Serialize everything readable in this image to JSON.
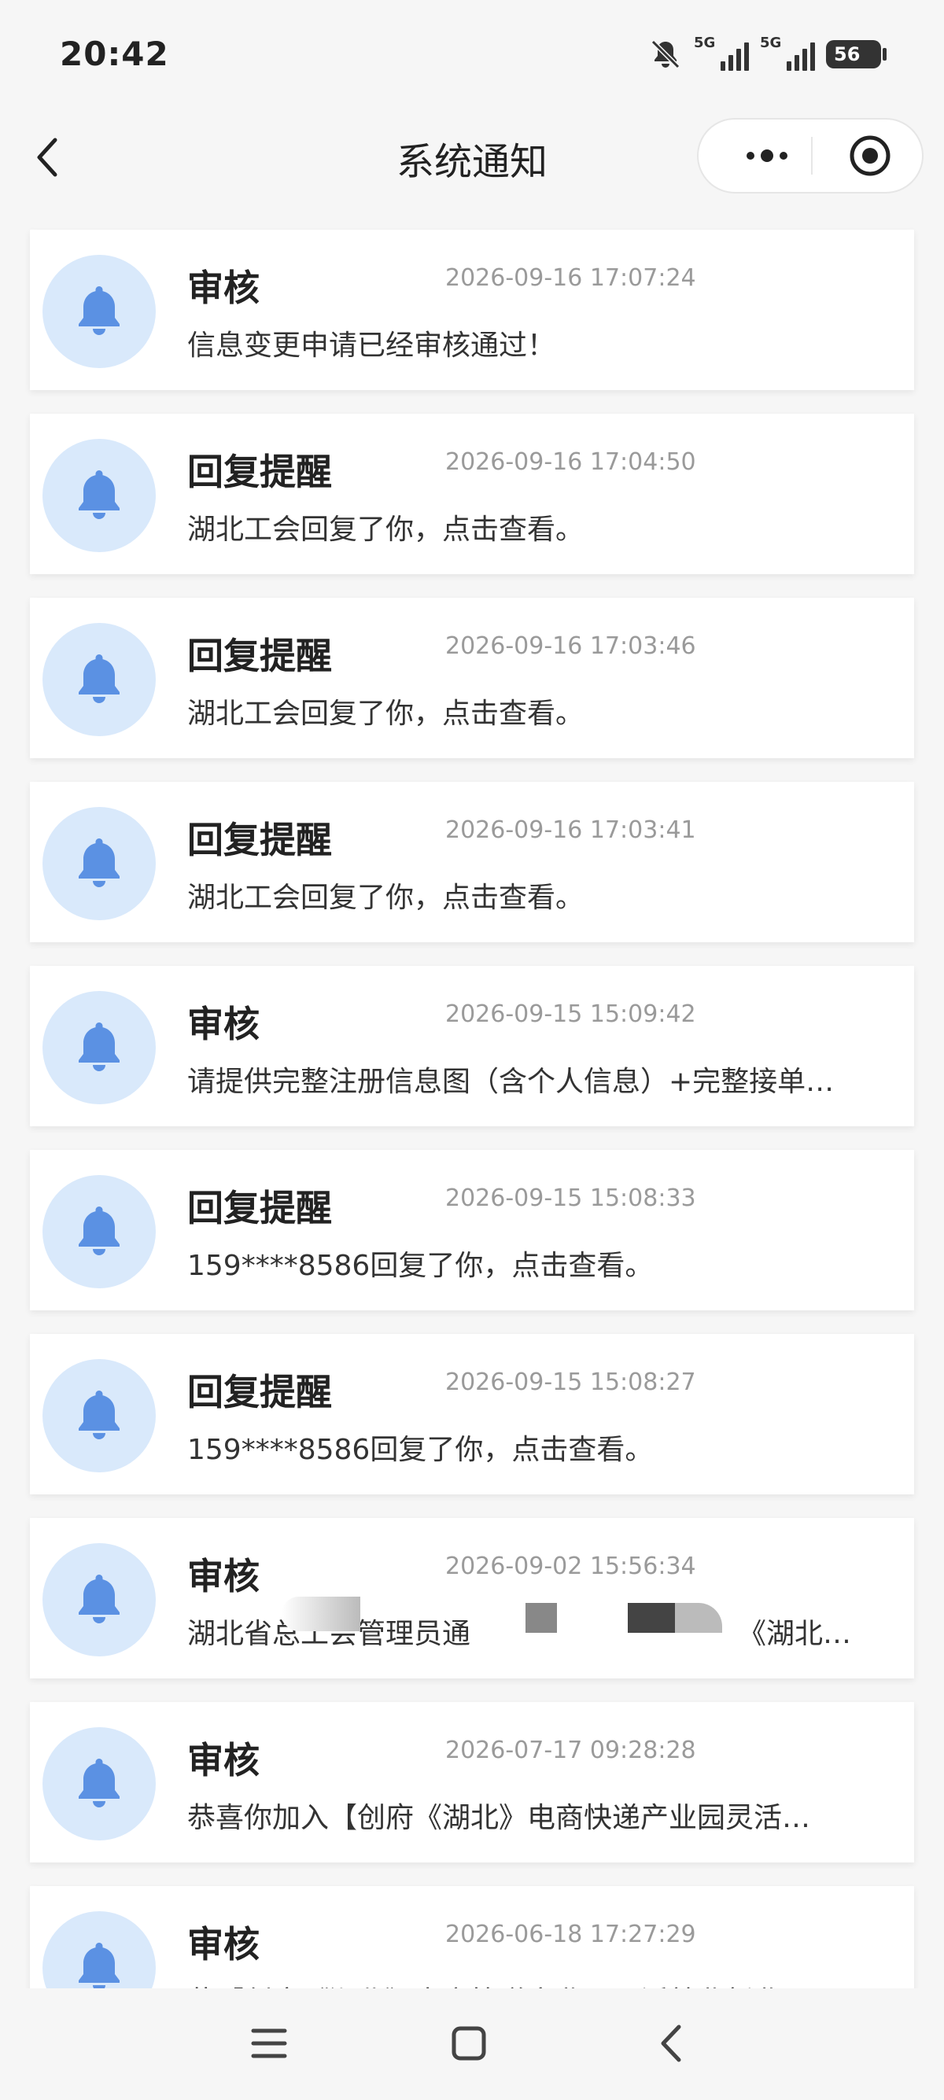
{
  "status_bar": {
    "time": "20:42",
    "network_1": "5G",
    "network_2": "5G",
    "battery": "56"
  },
  "navbar": {
    "title": "系统通知"
  },
  "notifications": [
    {
      "title": "审核",
      "time": "2026-09-16 17:07:24",
      "body": "信息变更申请已经审核通过！"
    },
    {
      "title": "回复提醒",
      "time": "2026-09-16 17:04:50",
      "body": "湖北工会回复了你，点击查看。"
    },
    {
      "title": "回复提醒",
      "time": "2026-09-16 17:03:46",
      "body": "湖北工会回复了你，点击查看。"
    },
    {
      "title": "回复提醒",
      "time": "2026-09-16 17:03:41",
      "body": "湖北工会回复了你，点击查看。"
    },
    {
      "title": "审核",
      "time": "2026-09-15 15:09:42",
      "body": "请提供完整注册信息图（含个人信息）+完整接单…"
    },
    {
      "title": "回复提醒",
      "time": "2026-09-15 15:08:33",
      "body": "159****8586回复了你，点击查看。"
    },
    {
      "title": "回复提醒",
      "time": "2026-09-15 15:08:27",
      "body": "159****8586回复了你，点击查看。"
    },
    {
      "title": "审核",
      "time": "2026-09-02 15:56:34",
      "body": "湖北省总工会管理员通",
      "body_tail": "《湖北…"
    },
    {
      "title": "审核",
      "time": "2026-07-17 09:28:28",
      "body": "恭喜你加入【创府《湖北》电商快递产业园灵活…"
    },
    {
      "title": "审核",
      "time": "2026-06-18 17:27:29",
      "body": "恭【创府《湖北》电商快递产业园灵活就业新业…"
    }
  ],
  "icons": {
    "back": "chevron-left-icon",
    "more": "more-dots-icon",
    "close": "target-circle-icon",
    "notification": "bell-icon",
    "menu": "menu-icon",
    "home": "home-square-icon",
    "nav_back": "chevron-left-icon"
  },
  "colors": {
    "accent_bell": "#5b91e3",
    "avatar_bg": "#d9e9fb",
    "time_text": "#9a9a9a"
  }
}
